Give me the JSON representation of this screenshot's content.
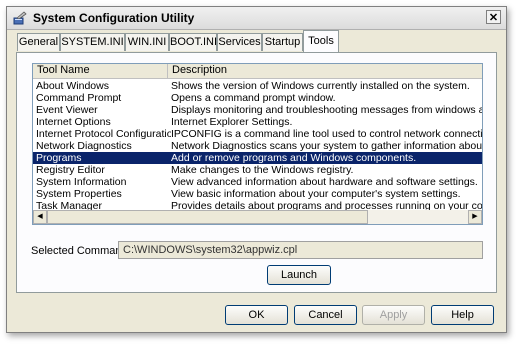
{
  "window": {
    "title": "System Configuration Utility",
    "close_label": "✕"
  },
  "tabs": [
    {
      "label": "General"
    },
    {
      "label": "SYSTEM.INI"
    },
    {
      "label": "WIN.INI"
    },
    {
      "label": "BOOT.INI"
    },
    {
      "label": "Services"
    },
    {
      "label": "Startup"
    },
    {
      "label": "Tools"
    }
  ],
  "active_tab": "Tools",
  "list": {
    "columns": [
      "Tool Name",
      "Description"
    ],
    "rows": [
      [
        "About Windows",
        "Shows the version of Windows currently installed on the system."
      ],
      [
        "Command Prompt",
        "Opens a command prompt window."
      ],
      [
        "Event Viewer",
        "Displays monitoring and troubleshooting messages from windows and other"
      ],
      [
        "Internet Options",
        "Internet Explorer Settings."
      ],
      [
        "Internet Protocol Configuration",
        "IPCONFIG is a command line tool used to control network connections on Wi"
      ],
      [
        "Network Diagnostics",
        "Network Diagnostics scans your system to gather information about your ha"
      ],
      [
        "Programs",
        "Add or remove programs and Windows components."
      ],
      [
        "Registry Editor",
        "Make changes to the Windows registry."
      ],
      [
        "System Information",
        "View advanced information about hardware and software settings."
      ],
      [
        "System Properties",
        "View basic information about your computer's system settings."
      ],
      [
        "Task Manager",
        "Provides details about programs and processes running on your computer."
      ]
    ],
    "selected_row": "Programs",
    "scroll_left": "◀",
    "scroll_right": "▶"
  },
  "selected_command": {
    "label": "Selected Command:",
    "value": "C:\\WINDOWS\\system32\\appwiz.cpl"
  },
  "launch_label": "Launch",
  "buttons": {
    "ok": "OK",
    "cancel": "Cancel",
    "apply": "Apply",
    "help": "Help"
  },
  "colors": {
    "selection": "#0a246a",
    "dialog_bg": "#ece9d8",
    "button_border": "#003c74"
  },
  "icons": {
    "app": "system-config-icon"
  }
}
